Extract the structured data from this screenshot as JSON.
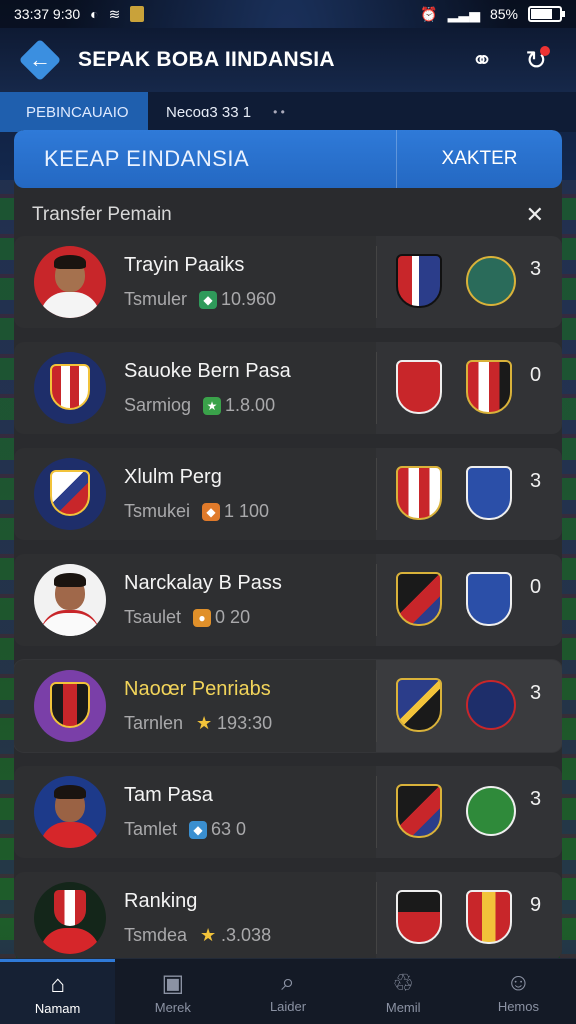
{
  "status_bar": {
    "time": "33:37 9:30",
    "battery": "85%"
  },
  "header": {
    "title": "SEPAK BOBA IINDANSIA"
  },
  "subnav": {
    "active_label": "PEBINCAUAIO",
    "item_label": "Necoɑ3 33",
    "item_count": "1",
    "dots": "•   •"
  },
  "tabs": {
    "main": "KEEAP EINDANSIA",
    "side": "XAKTER"
  },
  "list": {
    "heading": "Transfer Pemain",
    "close": "✕",
    "rows": [
      {
        "name": "Trayin Paaiks",
        "sub_label": "Tsmuler",
        "sub_value": "10.960",
        "count": "3"
      },
      {
        "name": "Sauoke Bern Pasa",
        "sub_label": "Sarmiog",
        "sub_value": "1.8.00",
        "count": "0"
      },
      {
        "name": "Xlulm Perg",
        "sub_label": "Tsmukei",
        "sub_value": "1     100",
        "count": "3"
      },
      {
        "name": "Narckalay B Pass",
        "sub_label": "Tsaulet",
        "sub_value": "0     20",
        "count": "0"
      },
      {
        "name": "Naoœr Penriabs",
        "sub_label": "Tarnlen",
        "sub_value": "193:30",
        "count": "3"
      },
      {
        "name": "Tam Pasa",
        "sub_label": "Tamlet",
        "sub_value": "63    0",
        "count": "3"
      },
      {
        "name": "Ranking",
        "sub_label": "Tsmdea",
        "sub_value": ".3.038",
        "count": "9"
      }
    ]
  },
  "bottom_nav": [
    {
      "label": "Namam",
      "icon": "home-icon"
    },
    {
      "label": "Merek",
      "icon": "jar-icon"
    },
    {
      "label": "Laider",
      "icon": "search-card-icon"
    },
    {
      "label": "Memil",
      "icon": "recycle-icon"
    },
    {
      "label": "Hemos",
      "icon": "user-icon"
    }
  ],
  "colors": {
    "accent": "#2f7ad8",
    "panel": "#2a2b2e",
    "row": "#323336",
    "gold_text": "#f2d45a"
  }
}
